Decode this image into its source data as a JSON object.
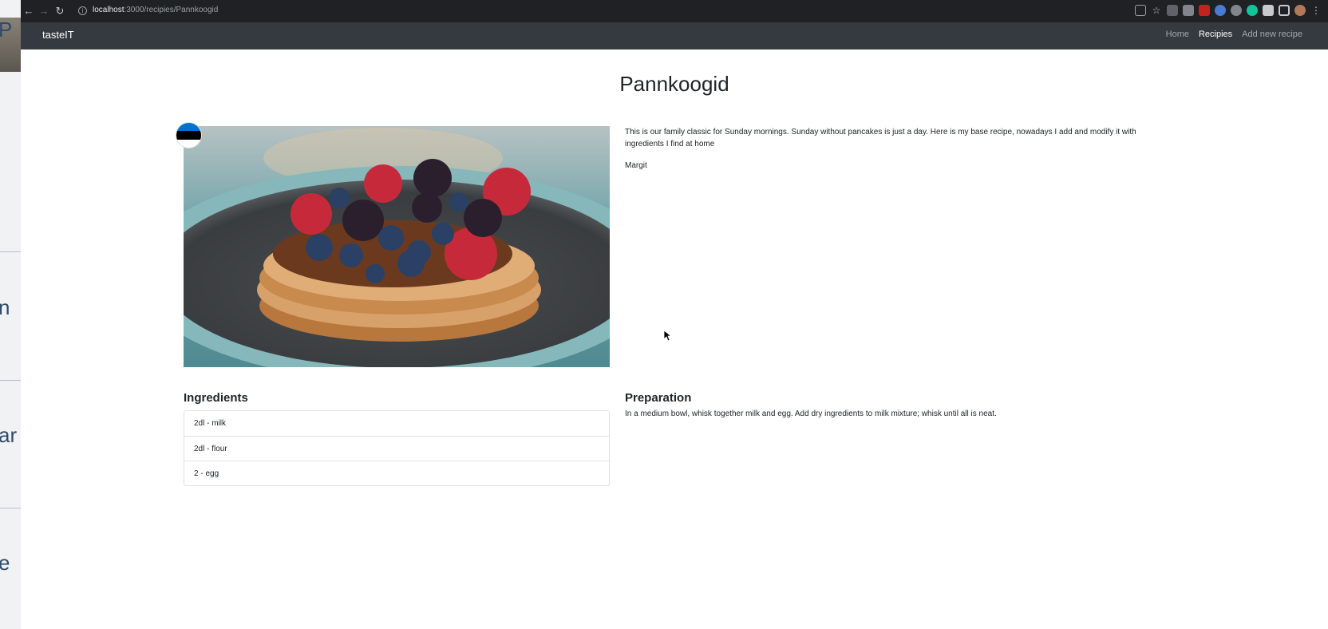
{
  "browser": {
    "url_host": "localhost",
    "url_path": ":3000/recipies/Pannkoogid"
  },
  "navbar": {
    "brand": "tasteIT",
    "links": [
      {
        "label": "Home",
        "active": false
      },
      {
        "label": "Recipies",
        "active": true
      },
      {
        "label": "Add new recipe",
        "active": false
      }
    ]
  },
  "recipe": {
    "title": "Pannkoogid",
    "description": "This is our family classic for Sunday mornings. Sunday without pancakes is just a day. Here is my base recipe, nowadays I add and modify it with ingredients I find at home",
    "author": "Margit",
    "image_alt": "pancakes-photo",
    "flag_colors": [
      "#0072ce",
      "#000000",
      "#ffffff"
    ]
  },
  "ingredients": {
    "heading": "Ingredients",
    "items": [
      "2dl - milk",
      "2dl - flour",
      "2 - egg"
    ]
  },
  "preparation": {
    "heading": "Preparation",
    "text": "In a medium bowl, whisk together milk and egg. Add dry ingredients to milk mixture; whisk until all is neat."
  },
  "background_window": {
    "letters": [
      "P",
      "n",
      "ar",
      "e"
    ]
  }
}
